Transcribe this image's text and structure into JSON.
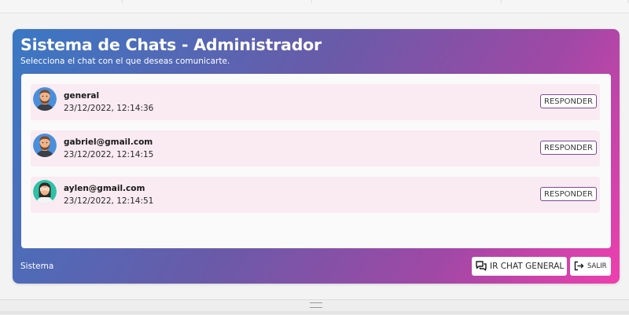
{
  "header": {
    "title": "Sistema de Chats - Administrador",
    "subtitle": "Selecciona el chat con el que deseas comunicarte."
  },
  "chats": [
    {
      "name": "general",
      "timestamp": "23/12/2022, 12:14:36",
      "reply_label": "RESPONDER",
      "avatar": "man-beard-avatar"
    },
    {
      "name": "gabriel@gmail.com",
      "timestamp": "23/12/2022, 12:14:15",
      "reply_label": "RESPONDER",
      "avatar": "man-beard-avatar"
    },
    {
      "name": "aylen@gmail.com",
      "timestamp": "23/12/2022, 12:14:51",
      "reply_label": "RESPONDER",
      "avatar": "woman-avatar"
    }
  ],
  "footer": {
    "label": "Sistema",
    "general_button": "IR CHAT GENERAL",
    "general_icon": "chat-bubbles-icon",
    "logout_button": "SALIR",
    "logout_icon": "logout-icon"
  },
  "colors": {
    "gradient_start": "#3a78c4",
    "gradient_end": "#ee3fae",
    "row_background": "#f9ebf1",
    "button_border": "#7b4a9c"
  }
}
